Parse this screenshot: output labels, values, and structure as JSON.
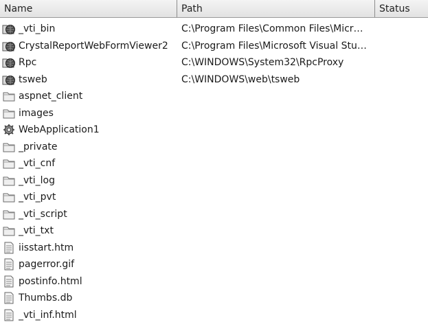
{
  "columns": {
    "name": "Name",
    "path": "Path",
    "status": "Status"
  },
  "rows": [
    {
      "name": "_vti_bin",
      "path": "C:\\Program Files\\Common Files\\Micr…",
      "icon": "globe-folder-icon"
    },
    {
      "name": "CrystalReportWebFormViewer2",
      "path": "C:\\Program Files\\Microsoft Visual Stu…",
      "icon": "globe-folder-icon"
    },
    {
      "name": "Rpc",
      "path": "C:\\WINDOWS\\System32\\RpcProxy",
      "icon": "globe-folder-icon"
    },
    {
      "name": "tsweb",
      "path": "C:\\WINDOWS\\web\\tsweb",
      "icon": "globe-folder-icon"
    },
    {
      "name": "aspnet_client",
      "path": "",
      "icon": "folder-icon"
    },
    {
      "name": "images",
      "path": "",
      "icon": "folder-icon"
    },
    {
      "name": "WebApplication1",
      "path": "",
      "icon": "web-application-icon"
    },
    {
      "name": "_private",
      "path": "",
      "icon": "folder-icon"
    },
    {
      "name": "_vti_cnf",
      "path": "",
      "icon": "folder-icon"
    },
    {
      "name": "_vti_log",
      "path": "",
      "icon": "folder-icon"
    },
    {
      "name": "_vti_pvt",
      "path": "",
      "icon": "folder-icon"
    },
    {
      "name": "_vti_script",
      "path": "",
      "icon": "folder-icon"
    },
    {
      "name": "_vti_txt",
      "path": "",
      "icon": "folder-icon"
    },
    {
      "name": "iisstart.htm",
      "path": "",
      "icon": "file-icon"
    },
    {
      "name": "pagerror.gif",
      "path": "",
      "icon": "file-icon"
    },
    {
      "name": "postinfo.html",
      "path": "",
      "icon": "file-icon"
    },
    {
      "name": "Thumbs.db",
      "path": "",
      "icon": "file-icon"
    },
    {
      "name": "_vti_inf.html",
      "path": "",
      "icon": "file-icon"
    }
  ]
}
